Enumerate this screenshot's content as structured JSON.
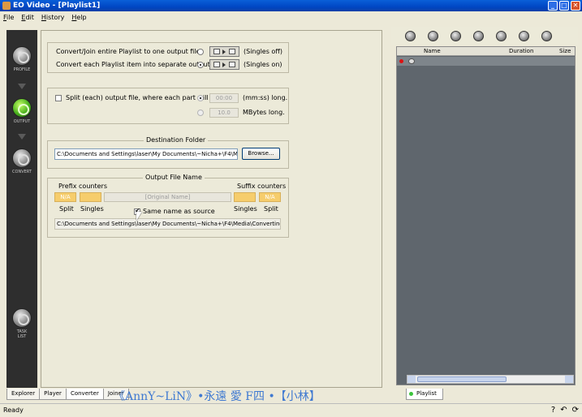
{
  "window": {
    "title": "EO Video - [Playlist1]",
    "min": "_",
    "max": "□",
    "close": "✕"
  },
  "menu": [
    "File",
    "Edit",
    "History",
    "Help"
  ],
  "sidebar": {
    "profile": "PROFILE",
    "output": "OUTPUT",
    "convert": "CONVERT",
    "tasklist_1": "TASK",
    "tasklist_2": "LIST"
  },
  "join": {
    "option1": "Convert/Join entire Playlist to one output file",
    "option1_note": "(Singles off)",
    "option2": "Convert each Playlist item into separate output file",
    "option2_note": "(Singles on)",
    "selected": 2
  },
  "split": {
    "label": "Split (each) output file, where each part will be",
    "time_value": "00:00",
    "time_unit": "(mm:ss) long.",
    "size_value": "10.0",
    "size_unit": "MBytes long."
  },
  "destination": {
    "title": "Destination Folder",
    "path": "C:\\Documents and Settings\\laser\\My Documents\\~Nicha+\\F4\\Me",
    "browse": "Browse..."
  },
  "output_name": {
    "title": "Output File Name",
    "prefix": "Prefix counters",
    "suffix": "Suffix counters",
    "na_left": "N/A",
    "na_right": "N/A",
    "original_name": "[Original Name]",
    "split_left": "Split",
    "singles_left": "Singles",
    "same_name": "Same name as source",
    "singles_right": "Singles",
    "split_right": "Split",
    "preview": "C:\\Documents and Settings\\laser\\My Documents\\~Nicha+\\F4\\Media\\Converting"
  },
  "playlist": {
    "col_name": "Name",
    "col_duration": "Duration",
    "col_size": "Size",
    "tab": "Playlist"
  },
  "tabs": [
    "Explorer",
    "Player",
    "Converter",
    "Joiner"
  ],
  "watermark": "《AnnY~LiN》•永遠 愛 F四 •【小林】",
  "status": {
    "text": "Ready",
    "help": "?"
  }
}
